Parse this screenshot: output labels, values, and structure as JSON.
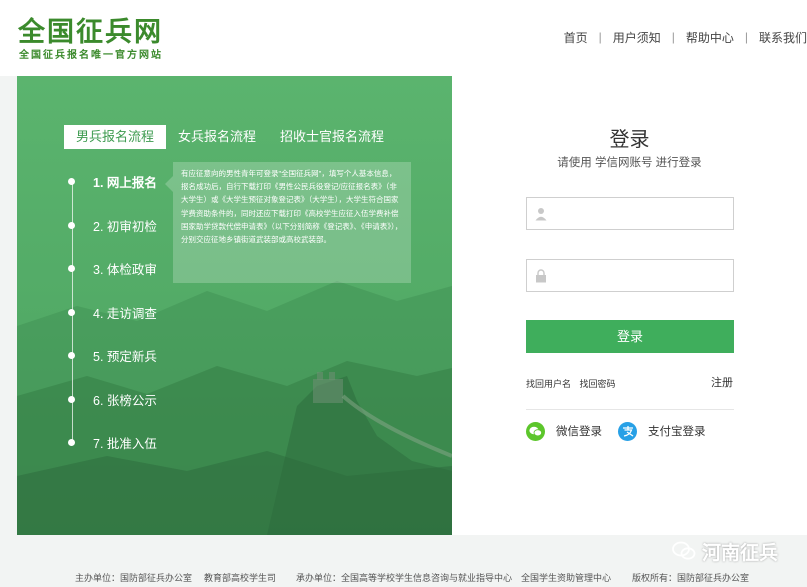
{
  "header": {
    "logo_title": "全国征兵网",
    "logo_subtitle": "全国征兵报名唯一官方网站",
    "nav": [
      {
        "label": "首页"
      },
      {
        "label": "用户须知"
      },
      {
        "label": "帮助中心"
      },
      {
        "label": "联系我们"
      }
    ],
    "nav_separator": "|"
  },
  "process": {
    "tabs": [
      {
        "label": "男兵报名流程"
      },
      {
        "label": "女兵报名流程"
      },
      {
        "label": "招收士官报名流程"
      }
    ],
    "steps": [
      {
        "label": "1. 网上报名"
      },
      {
        "label": "2. 初审初检"
      },
      {
        "label": "3. 体检政审"
      },
      {
        "label": "4. 走访调查"
      },
      {
        "label": "5. 预定新兵"
      },
      {
        "label": "6. 张榜公示"
      },
      {
        "label": "7. 批准入伍"
      }
    ],
    "description": "有应征意向的男性青年可登录\"全国征兵网\"，填写个人基本信息，报名成功后，自行下载打印《男性公民兵役登记/应征报名表》（非大学生）或《大学生预征对象登记表》（大学生），大学生符合国家学费资助条件的，同时还应下载打印《高校学生应征入伍学费补偿国家助学贷款代偿申请表》（以下分别简称《登记表》、《申请表》），分别交应征地乡镇街道武装部或高校武装部。"
  },
  "login": {
    "title": "登录",
    "subtitle": "请使用  学信网账号  进行登录",
    "username_placeholder": "",
    "password_placeholder": "",
    "button_label": "登录",
    "find_username": "找回用户名",
    "find_password": "找回密码",
    "register": "注册",
    "wechat_login": "微信登录",
    "alipay_login": "支付宝登录"
  },
  "footer": {
    "sponsor": "主办单位：国防部征兵办公室",
    "ministry": "教育部高校学生司",
    "organizer": "承办单位：全国高等学校学生信息咨询与就业指导中心",
    "aid_center": "全国学生资助管理中心",
    "copyright": "版权所有：国防部征兵办公室"
  },
  "watermark": {
    "text": "河南征兵"
  },
  "colors": {
    "brand_green": "#3b8a2c",
    "panel_green": "#52aa66",
    "button_green": "#3fae5c",
    "wechat_green": "#5cc62b",
    "alipay_blue": "#27a0e6"
  }
}
